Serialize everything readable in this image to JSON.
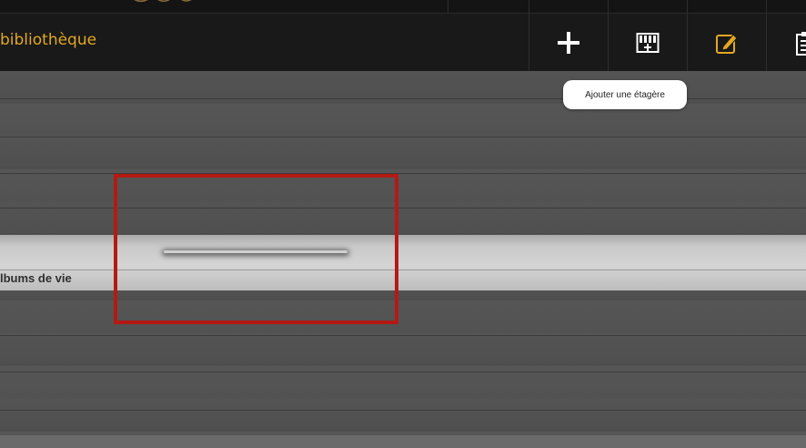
{
  "header": {
    "title": "bibliothèque",
    "logo_text": "...",
    "tools": [
      {
        "icon": "plus-icon",
        "label": "Ajouter une étagère"
      },
      {
        "icon": "add-shelf-grid-icon"
      },
      {
        "icon": "edit-pencil-icon"
      },
      {
        "icon": "clipboard-icon"
      }
    ]
  },
  "tooltip": {
    "text": "Ajouter une étagère"
  },
  "shelf": {
    "label": "lbums de vie"
  },
  "colors": {
    "accent": "#e2a822",
    "highlight": "#b41a14",
    "header_bg": "#191919"
  }
}
